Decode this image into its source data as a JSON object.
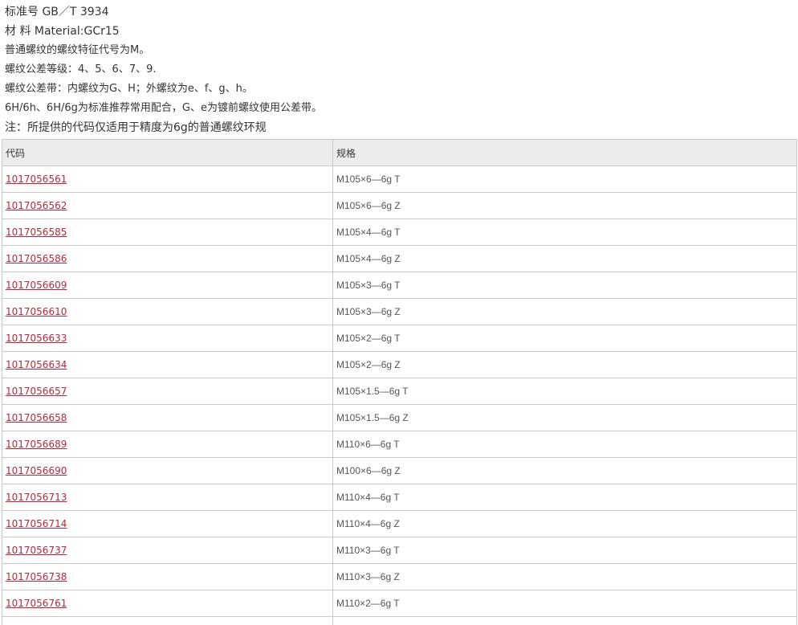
{
  "intro": [
    "标准号 GB／T 3934",
    "材 料 Material:GCr15",
    "普通螺纹的螺纹特征代号为M。",
    "螺纹公差等级：4、5、6、7、9.",
    "螺纹公差带：内螺纹为G、H；外螺纹为e、f、g、h。",
    "6H/6h、6H/6g为标准推荐常用配合，G、e为镀前螺纹使用公差带。",
    "注：所提供的代码仅适用于精度为6g的普通螺纹环规"
  ],
  "table": {
    "headers": [
      "代码",
      "规格"
    ],
    "rows": [
      {
        "code": "1017056561",
        "spec": "M105×6—6g T"
      },
      {
        "code": "1017056562",
        "spec": "M105×6—6g Z"
      },
      {
        "code": "1017056585",
        "spec": "M105×4—6g T"
      },
      {
        "code": "1017056586",
        "spec": "M105×4—6g Z"
      },
      {
        "code": "1017056609",
        "spec": "M105×3—6g T"
      },
      {
        "code": "1017056610",
        "spec": "M105×3—6g Z"
      },
      {
        "code": "1017056633",
        "spec": "M105×2—6g T"
      },
      {
        "code": "1017056634",
        "spec": "M105×2—6g Z"
      },
      {
        "code": "1017056657",
        "spec": "M105×1.5—6g T"
      },
      {
        "code": "1017056658",
        "spec": "M105×1.5—6g Z"
      },
      {
        "code": "1017056689",
        "spec": "M110×6—6g T"
      },
      {
        "code": "1017056690",
        "spec": "M100×6—6g Z"
      },
      {
        "code": "1017056713",
        "spec": "M110×4—6g T"
      },
      {
        "code": "1017056714",
        "spec": "M110×4—6g Z"
      },
      {
        "code": "1017056737",
        "spec": "M110×3—6g T"
      },
      {
        "code": "1017056738",
        "spec": "M110×3—6g Z"
      },
      {
        "code": "1017056761",
        "spec": "M110×2—6g T"
      },
      {
        "code": "",
        "spec": ""
      }
    ]
  },
  "colors": {
    "link": "#b8283a",
    "header_bg": "#ececec",
    "border": "#c8c8c8"
  }
}
